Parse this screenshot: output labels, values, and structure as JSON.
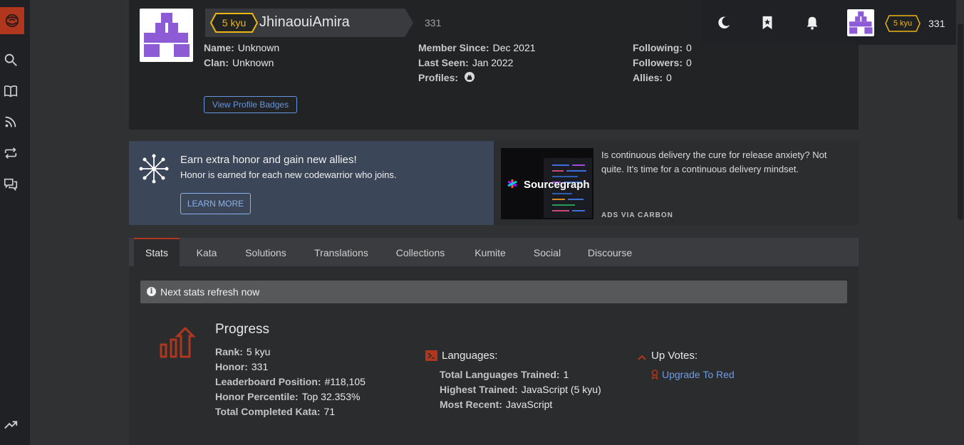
{
  "sidebar": {
    "items": [
      {
        "icon": "codewars-logo-icon"
      },
      {
        "icon": "search-icon"
      },
      {
        "icon": "book-icon"
      },
      {
        "icon": "rss-icon"
      },
      {
        "icon": "repeat-icon"
      },
      {
        "icon": "chat-icon"
      },
      {
        "icon": "trending-icon"
      }
    ]
  },
  "profile": {
    "rank_badge": "5 kyu",
    "username": "JhinaouiAmira",
    "honor": "331",
    "col1": [
      {
        "label": "Name:",
        "value": "Unknown"
      },
      {
        "label": "Clan:",
        "value": "Unknown"
      }
    ],
    "col2": [
      {
        "label": "Member Since:",
        "value": "Dec 2021"
      },
      {
        "label": "Last Seen:",
        "value": "Jan 2022"
      },
      {
        "label": "Profiles:",
        "value": ""
      }
    ],
    "col3": [
      {
        "label": "Following:",
        "value": "0"
      },
      {
        "label": "Followers:",
        "value": "0"
      },
      {
        "label": "Allies:",
        "value": "0"
      }
    ],
    "view_badges": "View Profile Badges"
  },
  "header": {
    "rank_badge": "5 kyu",
    "honor": "331"
  },
  "promo": {
    "title": "Earn extra honor and gain new allies!",
    "subtitle": "Honor is earned for each new codewarrior who joins.",
    "button": "LEARN MORE"
  },
  "ad": {
    "brand": "Sourcegraph",
    "text": "Is continuous delivery the cure for release anxiety? Not quite. It's time for a continuous delivery mindset.",
    "via": "ADS VIA CARBON"
  },
  "tabs": [
    "Stats",
    "Kata",
    "Solutions",
    "Translations",
    "Collections",
    "Kumite",
    "Social",
    "Discourse"
  ],
  "stats": {
    "refresh_notice": "Next stats refresh now",
    "progress": {
      "title": "Progress",
      "rows": [
        {
          "label": "Rank:",
          "value": "5 kyu"
        },
        {
          "label": "Honor:",
          "value": "331"
        },
        {
          "label": "Leaderboard Position:",
          "value": "#118,105"
        },
        {
          "label": "Honor Percentile:",
          "value": "Top 32.353%"
        },
        {
          "label": "Total Completed Kata:",
          "value": "71"
        }
      ]
    },
    "languages": {
      "title": "Languages:",
      "rows": [
        {
          "label": "Total Languages Trained:",
          "value": "1"
        },
        {
          "label": "Highest Trained:",
          "value": "JavaScript (5 kyu)"
        },
        {
          "label": "Most Recent:",
          "value": "JavaScript"
        }
      ]
    },
    "upvotes": {
      "title": "Up Votes:",
      "link": "Upgrade To Red"
    }
  },
  "colors": {
    "accent_red": "#b1361e",
    "kyu_yellow": "#ecb613",
    "link_blue": "#6795de"
  }
}
